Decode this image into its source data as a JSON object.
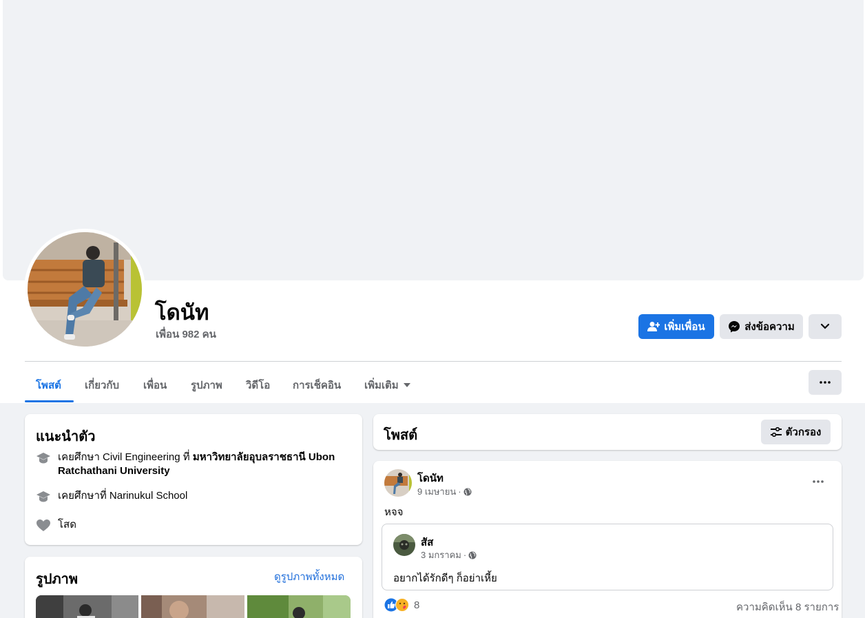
{
  "profile": {
    "name": "โดนัท",
    "friends": "เพื่อน 982 คน"
  },
  "actions": {
    "add_friend": "เพิ่มเพื่อน",
    "message": "ส่งข้อความ"
  },
  "tabs": [
    {
      "label": "โพสต์",
      "active": true
    },
    {
      "label": "เกี่ยวกับ"
    },
    {
      "label": "เพื่อน"
    },
    {
      "label": "รูปภาพ"
    },
    {
      "label": "วิดีโอ"
    },
    {
      "label": "การเช็คอิน"
    },
    {
      "label": "เพิ่มเติม"
    }
  ],
  "intro": {
    "title": "แนะนำตัว",
    "edu1_prefix": "เคยศึกษา Civil Engineering ที่ ",
    "edu1_school": "มหาวิทยาลัยอุบลราชธานี Ubon Ratchathani University",
    "edu2": "เคยศึกษาที่ Narinukul School",
    "relationship": "โสด"
  },
  "photos": {
    "title": "รูปภาพ",
    "see_all": "ดูรูปภาพทั้งหมด"
  },
  "posts_header": {
    "title": "โพสต์",
    "filter": "ตัวกรอง"
  },
  "post": {
    "author": "โดนัท",
    "date": "9 เมษายน",
    "text": "หจจ",
    "shared": {
      "author": "สัส",
      "date": "3 มกราคม",
      "text": "อยากได้รักดีๆ ก็อย่าเหี้ย"
    },
    "reaction_count": "8",
    "comments": "ความคิดเห็น 8 รายการ"
  },
  "colors": {
    "accent": "#1b74e4",
    "background": "#f0f2f5",
    "secondary_text": "#65676b"
  }
}
